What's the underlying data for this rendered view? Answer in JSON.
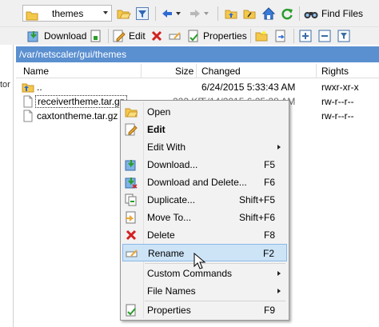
{
  "toolbar_top": {
    "folder_combo_value": "themes",
    "find_files_label": "Find Files"
  },
  "toolbar_bottom": {
    "download_label": "Download",
    "edit_label": "Edit",
    "properties_label": "Properties"
  },
  "left_pane": {
    "stub_text": "tor"
  },
  "path_bar": {
    "path": "/var/netscaler/gui/themes"
  },
  "file_list": {
    "columns": {
      "name": "Name",
      "size": "Size",
      "changed": "Changed",
      "rights": "Rights"
    },
    "rows": [
      {
        "name": "..",
        "size": "",
        "changed": "6/24/2015 5:33:43 AM",
        "rights": "rwxr-xr-x"
      },
      {
        "name": "receivertheme.tar.gz",
        "size": "222 KB",
        "changed": "5/14/2015 6:25:28 AM",
        "rights": "rw-r--r--"
      },
      {
        "name": "caxtontheme.tar.gz",
        "size": "",
        "changed": "",
        "rights": "rw-r--r--"
      }
    ]
  },
  "context_menu": {
    "open": "Open",
    "edit": "Edit",
    "edit_with": "Edit With",
    "download": "Download...",
    "download_key": "F5",
    "download_delete": "Download and Delete...",
    "download_delete_key": "F6",
    "duplicate": "Duplicate...",
    "duplicate_key": "Shift+F5",
    "move_to": "Move To...",
    "move_to_key": "Shift+F6",
    "delete": "Delete",
    "delete_key": "F8",
    "rename": "Rename",
    "rename_key": "F2",
    "custom_commands": "Custom Commands",
    "file_names": "File Names",
    "properties": "Properties",
    "properties_key": "F9"
  },
  "colors": {
    "path_bar_bg": "#5a8fd0",
    "menu_highlight": "#cde4f7",
    "folder_yellow": "#f4c84a"
  }
}
